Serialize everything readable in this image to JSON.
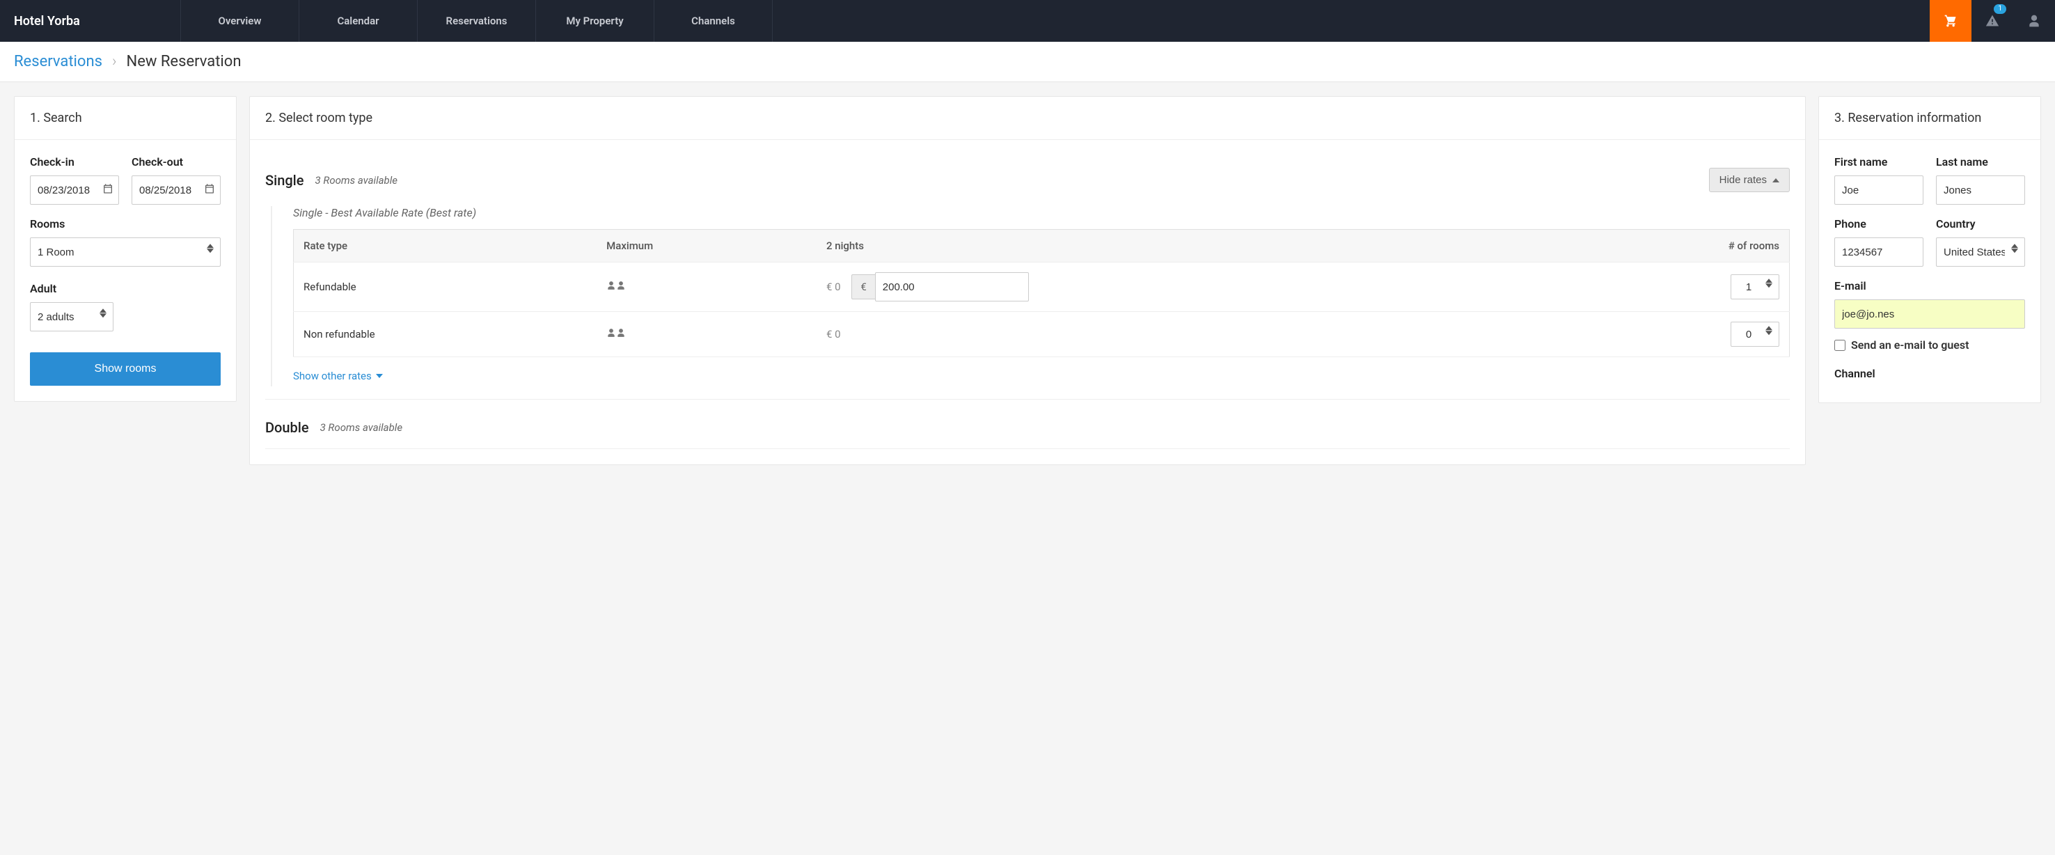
{
  "brand": "Hotel Yorba",
  "nav": {
    "items": [
      "Overview",
      "Calendar",
      "Reservations",
      "My Property",
      "Channels"
    ],
    "alert_badge": "1"
  },
  "breadcrumb": {
    "root": "Reservations",
    "current": "New Reservation"
  },
  "search": {
    "title": "1. Search",
    "checkin_label": "Check-in",
    "checkout_label": "Check-out",
    "checkin": "08/23/2018",
    "checkout": "08/25/2018",
    "rooms_label": "Rooms",
    "rooms_value": "1 Room",
    "adult_label": "Adult",
    "adult_value": "2 adults",
    "show_rooms": "Show rooms"
  },
  "roomtype": {
    "title": "2. Select room type",
    "single": {
      "name": "Single",
      "avail": "3 Rooms available",
      "hide_rates": "Hide rates",
      "rate_name": "Single - Best Available Rate (Best rate)",
      "headers": {
        "rate_type": "Rate type",
        "max": "Maximum",
        "nights": "2 nights",
        "qty": "# of rooms"
      },
      "rows": {
        "refundable": {
          "label": "Refundable",
          "base": "€ 0",
          "currency": "€",
          "price": "200.00",
          "qty": "1"
        },
        "nonrefundable": {
          "label": "Non refundable",
          "base": "€ 0",
          "qty": "0"
        }
      },
      "show_other": "Show other rates"
    },
    "double": {
      "name": "Double",
      "avail": "3 Rooms available"
    }
  },
  "resinfo": {
    "title": "3. Reservation information",
    "first_name_label": "First name",
    "last_name_label": "Last name",
    "first_name": "Joe",
    "last_name": "Jones",
    "phone_label": "Phone",
    "country_label": "Country",
    "phone": "1234567",
    "country": "United States",
    "email_label": "E-mail",
    "email": "joe@jo.nes",
    "send_email_label": "Send an e-mail to guest",
    "channel_label": "Channel"
  }
}
